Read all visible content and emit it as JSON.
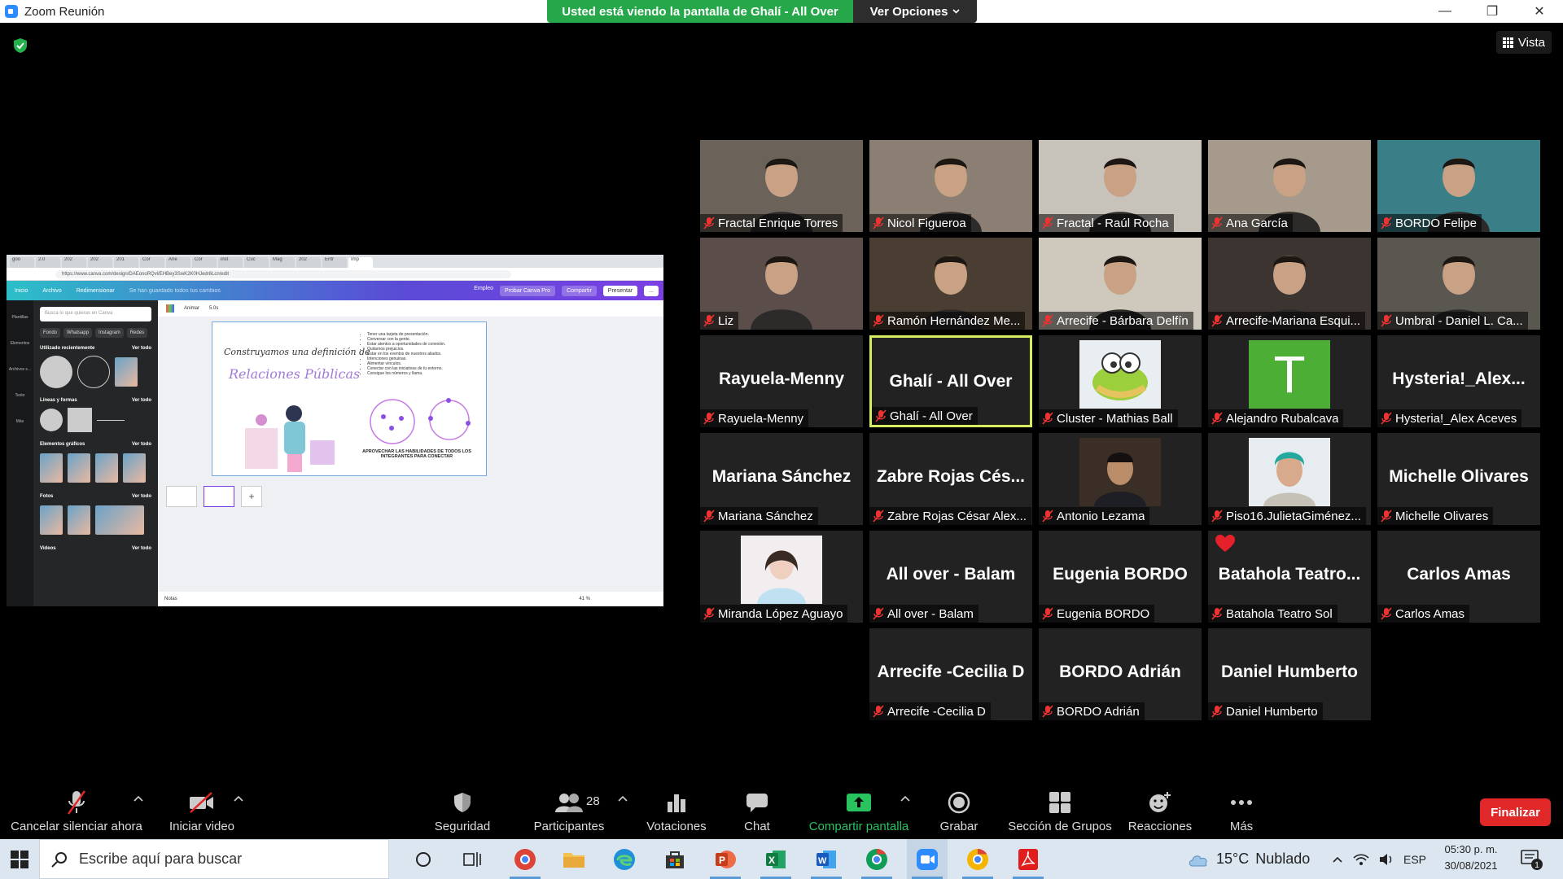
{
  "window": {
    "title": "Zoom Reunión",
    "minimize": "—",
    "maximize": "❐",
    "close": "✕"
  },
  "banner": {
    "message": "Usted está viendo la pantalla de Ghalí - All Over",
    "options": "Ver Opciones"
  },
  "view_button": {
    "label": "Vista"
  },
  "shared_screen": {
    "url": "https://www.canva.com/design/DAEonoRQvl/EHBey3SwK2K0HJedr6Lcn/edit",
    "browser_tabs": [
      "goo",
      "2.0",
      "202",
      "202",
      "201",
      "Cor",
      "Ane",
      "Cor",
      "inst",
      "Cuc",
      "Mag",
      "202",
      "Entr",
      "Imp"
    ],
    "menu": [
      "Inicio",
      "Archivo",
      "Redimensionar",
      "Se han guardado todos tus cambios"
    ],
    "menu_right": [
      "Empleo",
      "Probar Canva Pro",
      "Compartir",
      "Presentar",
      "..."
    ],
    "rail": [
      "Plantillas",
      "Elementos",
      "Archivos s...",
      "Texto",
      "Más"
    ],
    "search_placeholder": "Busca lo que quieras en Canva",
    "chips": [
      "Fondo",
      "Whatsapp",
      "Instagram",
      "Redes"
    ],
    "sections": {
      "recent": "Utilizado recientemente",
      "lines": "Líneas y formas",
      "graphics": "Elementos gráficos",
      "photos": "Fotos",
      "videos": "Videos",
      "see_all": "Ver todo"
    },
    "canvas_toolbar": [
      "Animar",
      "5.0s"
    ],
    "slide": {
      "title1": "Construyamos una definición de",
      "title2": "Relaciones Públicas",
      "bullets": [
        "Tener una tarjeta de presentación.",
        "Conversar con la gente.",
        "Estar atentos a oportunidades de conexión.",
        "Quitarnos prejuicios.",
        "Estar en los eventos de nuestros aliados.",
        "Intenciones genuinas.",
        "Alimentar vínculos.",
        "Conectar con las iniciativas de tu entorno.",
        "Consigue los números y llama."
      ],
      "footer": "APROVECHAR LAS HABILIDADES DE TODOS LOS INTEGRANTES PARA CONECTAR"
    },
    "status": {
      "notes": "Notas",
      "zoom": "41 %"
    }
  },
  "participants": [
    {
      "name": "Fractal Enrique Torres",
      "video": true,
      "bg": "#6b6259"
    },
    {
      "name": "Nicol Figueroa",
      "video": true,
      "bg": "#8a7f72"
    },
    {
      "name": "Fractal - Raúl Rocha",
      "video": true,
      "bg": "#c7c2ba"
    },
    {
      "name": "Ana García",
      "video": true,
      "bg": "#a59a8c"
    },
    {
      "name": "BORDO Felipe",
      "video": true,
      "bg": "#3a7f87"
    },
    {
      "name": "Liz",
      "video": true,
      "bg": "#5b4e4a"
    },
    {
      "name": "Ramón Hernández Me...",
      "video": true,
      "bg": "#4a3d31"
    },
    {
      "name": "Arrecife - Bárbara Delfín",
      "video": true,
      "bg": "#cfc8bd"
    },
    {
      "name": "Arrecife-Mariana Esqui...",
      "video": true,
      "bg": "#3c3431"
    },
    {
      "name": "Umbral - Daniel L. Ca...",
      "video": true,
      "bg": "#5a5650"
    },
    {
      "name": "Rayuela-Menny",
      "big": "Rayuela-Menny"
    },
    {
      "name": "Ghalí - All Over",
      "big": "Ghalí - All Over",
      "active": true
    },
    {
      "name": "Cluster - Mathias Ball",
      "avatar": "cartoon"
    },
    {
      "name": "Alejandro Rubalcava",
      "avatar": "T"
    },
    {
      "name": "Hysteria!_Alex Aceves",
      "big": "Hysteria!_Alex..."
    },
    {
      "name": "Mariana Sánchez",
      "big": "Mariana Sánchez"
    },
    {
      "name": "Zabre Rojas César Alex...",
      "big": "Zabre Rojas Cés..."
    },
    {
      "name": "Antonio Lezama",
      "avatar": "photo-dark"
    },
    {
      "name": "Piso16.JulietaGiménez...",
      "avatar": "photo-light"
    },
    {
      "name": "Michelle Olivares",
      "big": "Michelle Olivares"
    },
    {
      "name": "Miranda López Aguayo",
      "avatar": "photo-pink"
    },
    {
      "name": "All over - Balam",
      "big": "All over - Balam"
    },
    {
      "name": "Eugenia BORDO",
      "big": "Eugenia BORDO"
    },
    {
      "name": "Batahola Teatro Sol",
      "big": "Batahola  Teatro...",
      "heart": true
    },
    {
      "name": "Carlos Amas",
      "big": "Carlos Amas"
    },
    {
      "name": "Arrecife -Cecilia D",
      "big": "Arrecife -Cecilia D"
    },
    {
      "name": "BORDO Adrián",
      "big": "BORDO Adrián"
    },
    {
      "name": "Daniel Humberto",
      "big": "Daniel Humberto"
    }
  ],
  "toolbar": {
    "unmute": "Cancelar silenciar ahora",
    "start_video": "Iniciar video",
    "security": "Seguridad",
    "participants": "Participantes",
    "participants_count": "28",
    "polls": "Votaciones",
    "chat": "Chat",
    "share": "Compartir pantalla",
    "record": "Grabar",
    "breakout": "Sección de Grupos",
    "reactions": "Reacciones",
    "more": "Más",
    "end": "Finalizar"
  },
  "taskbar": {
    "search_placeholder": "Escribe aquí para buscar",
    "weather_temp": "15°C",
    "weather_text": "Nublado",
    "lang": "ESP",
    "time": "05:30 p. m.",
    "date": "30/08/2021",
    "notifications": "1"
  },
  "colors": {
    "accent_share": "#28c25f",
    "banner_green": "#26a84a",
    "end_red": "#e02828",
    "active_speaker": "#d9ec61"
  }
}
